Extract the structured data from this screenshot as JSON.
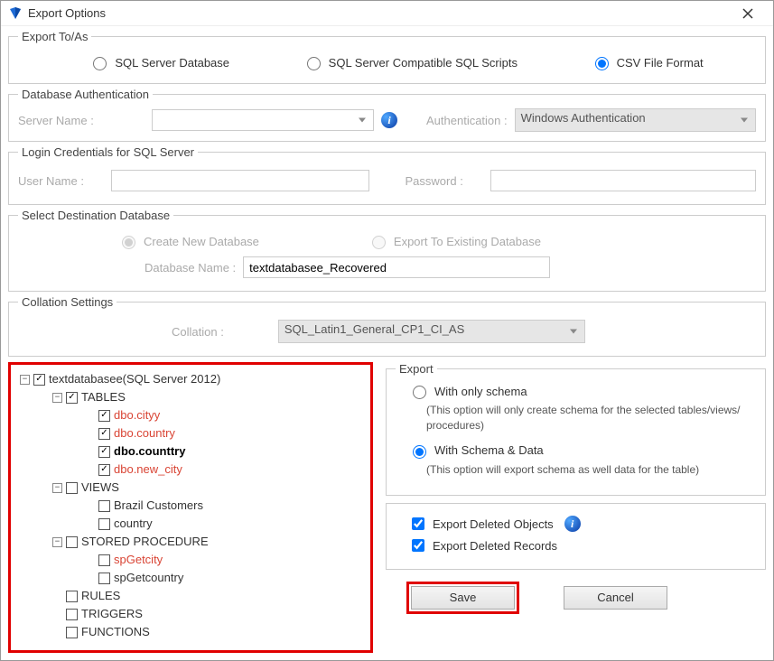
{
  "window": {
    "title": "Export Options"
  },
  "exportToAs": {
    "legend": "Export To/As",
    "options": [
      "SQL Server Database",
      "SQL Server Compatible SQL Scripts",
      "CSV File Format"
    ],
    "selected": "CSV File Format"
  },
  "dbAuth": {
    "legend": "Database Authentication",
    "serverNameLabel": "Server Name :",
    "serverNameValue": "",
    "authenticationLabel": "Authentication :",
    "authenticationValue": "Windows Authentication"
  },
  "login": {
    "legend": "Login Credentials for SQL Server",
    "userNameLabel": "User Name :",
    "userNameValue": "",
    "passwordLabel": "Password :",
    "passwordValue": ""
  },
  "destDb": {
    "legend": "Select Destination Database",
    "options": [
      "Create New Database",
      "Export To Existing Database"
    ],
    "selected": "Create New Database",
    "dbNameLabel": "Database Name :",
    "dbNameValue": "textdatabasee_Recovered"
  },
  "collation": {
    "legend": "Collation Settings",
    "label": "Collation :",
    "value": "SQL_Latin1_General_CP1_CI_AS"
  },
  "tree": {
    "root": "textdatabasee(SQL Server 2012)",
    "tables": {
      "label": "TABLES",
      "items": [
        "dbo.cityy",
        "dbo.country",
        "dbo.counttry",
        "dbo.new_city"
      ]
    },
    "views": {
      "label": "VIEWS",
      "items": [
        "Brazil Customers",
        "country"
      ]
    },
    "storedProc": {
      "label": "STORED PROCEDURE",
      "items": [
        "spGetcity",
        "spGetcountry"
      ]
    },
    "rules": "RULES",
    "triggers": "TRIGGERS",
    "functions": "FUNCTIONS"
  },
  "exportBox": {
    "legend": "Export",
    "onlySchema": {
      "label": "With only schema",
      "desc": "(This option will only create schema for the  selected tables/views/ procedures)"
    },
    "schemaData": {
      "label": "With Schema & Data",
      "desc": "(This option will export schema as well data for the table)"
    },
    "selected": "With Schema & Data"
  },
  "options": {
    "exportDeletedObjects": "Export Deleted Objects",
    "exportDeletedRecords": "Export Deleted Records"
  },
  "buttons": {
    "save": "Save",
    "cancel": "Cancel"
  }
}
